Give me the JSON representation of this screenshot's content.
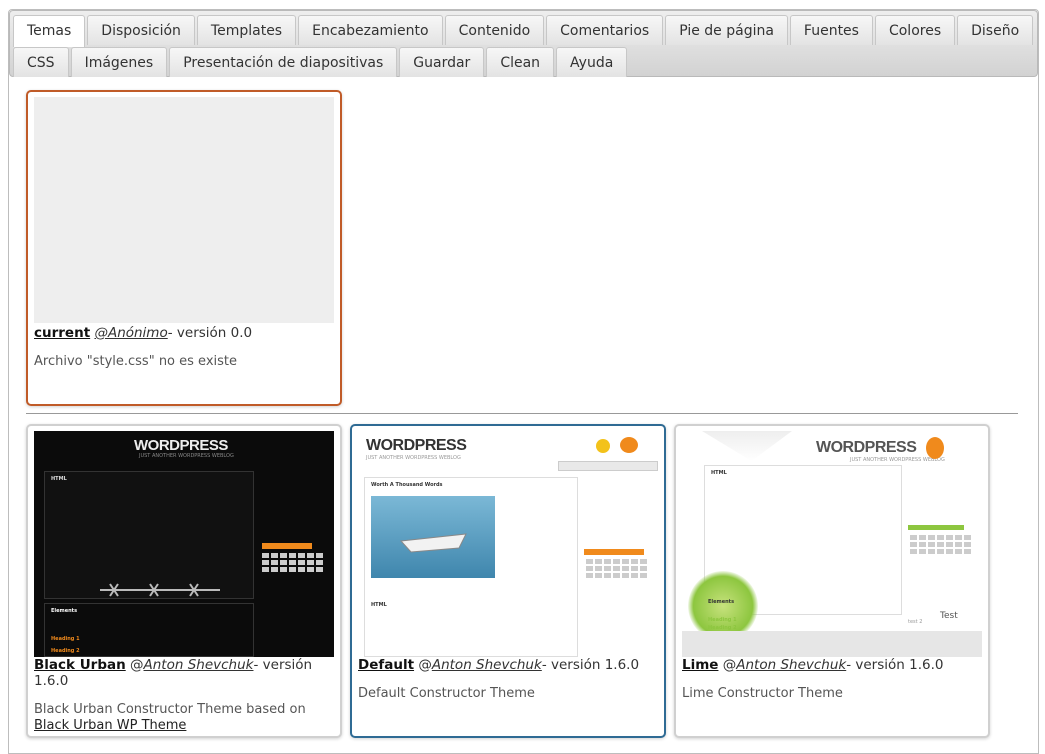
{
  "tabs_row1": [
    "Temas",
    "Disposición",
    "Templates",
    "Encabezamiento",
    "Contenido",
    "Comentarios",
    "Pie de página",
    "Fuentes",
    "Colores",
    "Diseño"
  ],
  "tabs_row2": [
    "CSS",
    "Imágenes",
    "Presentación de diapositivas",
    "Guardar",
    "Clean",
    "Ayuda"
  ],
  "current": {
    "name": "current",
    "author": "@Anónimo",
    "version": "- versión 0.0",
    "description": "Archivo \"style.css\" no es existe"
  },
  "themes": [
    {
      "name": "Black Urban",
      "at": "@",
      "author": "Anton Shevchuk",
      "version": "- versión 1.6.0",
      "description": "Black Urban Constructor Theme based on",
      "link": "Black Urban WP Theme"
    },
    {
      "name": "Default",
      "at": "@",
      "author": "Anton Shevchuk",
      "version": "- versión 1.6.0",
      "description": "Default Constructor Theme"
    },
    {
      "name": "Lime",
      "at": "@",
      "author": "Anton Shevchuk",
      "version": "- versión 1.6.0",
      "description": "Lime Constructor Theme"
    }
  ],
  "thumbs": {
    "wordpress": "WORDPRESS",
    "tagline": "JUST ANOTHER WORDPRESS WEBLOG",
    "default_post": "Worth A Thousand Words",
    "html_heading": "HTML",
    "elements": "Elements",
    "heading1": "Heading 1",
    "heading2": "Heading 2",
    "lime_test": "Test",
    "lime_test2": "test 2"
  },
  "colors": {
    "current_border": "#c05b28",
    "selected_border": "#2f6b94",
    "orange_accent": "#f08a1c",
    "lime_green": "#8dc63f"
  }
}
